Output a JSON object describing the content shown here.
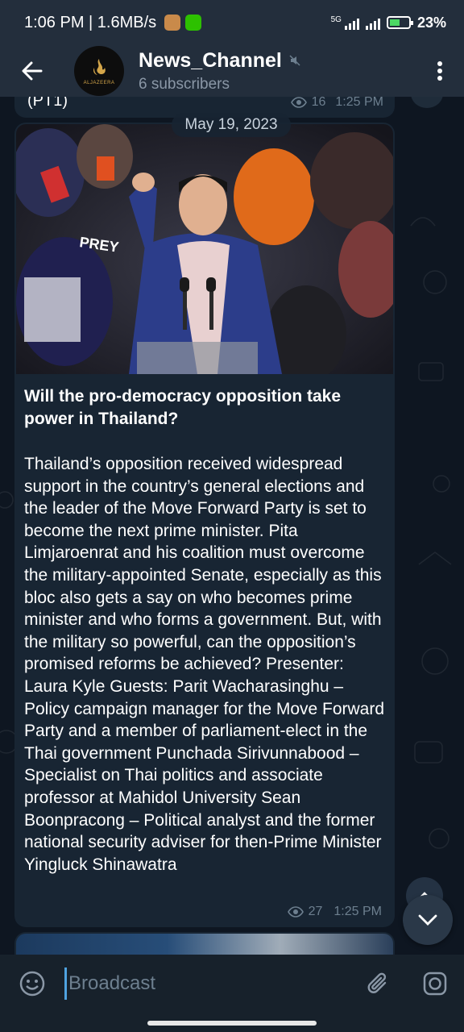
{
  "status_bar": {
    "time_speed": "1:06 PM | 1.6MB/s",
    "network": "5G",
    "battery": "23%"
  },
  "header": {
    "channel_name": "News_Channel",
    "subscribers": "6 subscribers",
    "avatar_text": "ALJAZEERA"
  },
  "previous_message": {
    "text_fragment": "(PT1)",
    "views": "16",
    "time": "1:25 PM"
  },
  "date_chip": "May 19, 2023",
  "message": {
    "headline": "Will the pro-democracy opposition take power in Thailand?",
    "body": "Thailand’s opposition received widespread support in the country’s general elections and the leader of the Move Forward Party is set to become the next prime minister. Pita Limjaroenrat and his coalition must overcome the military-appointed Senate, especially as this bloc also gets a say on who becomes prime minister and who forms a government. But, with the military so powerful, can the opposition’s promised reforms be achieved? Presenter: Laura Kyle Guests: Parit Wacharasinghu – Policy campaign manager for the Move Forward Party and a member of parliament-elect in the Thai government Punchada Sirivunnabood – Specialist on Thai politics and associate professor at Mahidol University Sean Boonpracong – Political analyst and the former national security adviser for then-Prime Minister Yingluck Shinawatra",
    "views": "27",
    "time": "1:25 PM",
    "photo_sign_text": "PREY"
  },
  "composer": {
    "placeholder": "Broadcast"
  },
  "colors": {
    "header_bg": "#232e3c",
    "chat_bg": "#0e1621",
    "bubble_bg": "#182533",
    "meta_text": "#6d7f8f",
    "accent": "#4fa3e0"
  },
  "icons": [
    "back-arrow-icon",
    "mute-icon",
    "more-vert-icon",
    "eye-icon",
    "chevron-up-icon",
    "chevron-down-icon",
    "emoji-icon",
    "attach-icon",
    "camera-icon"
  ]
}
